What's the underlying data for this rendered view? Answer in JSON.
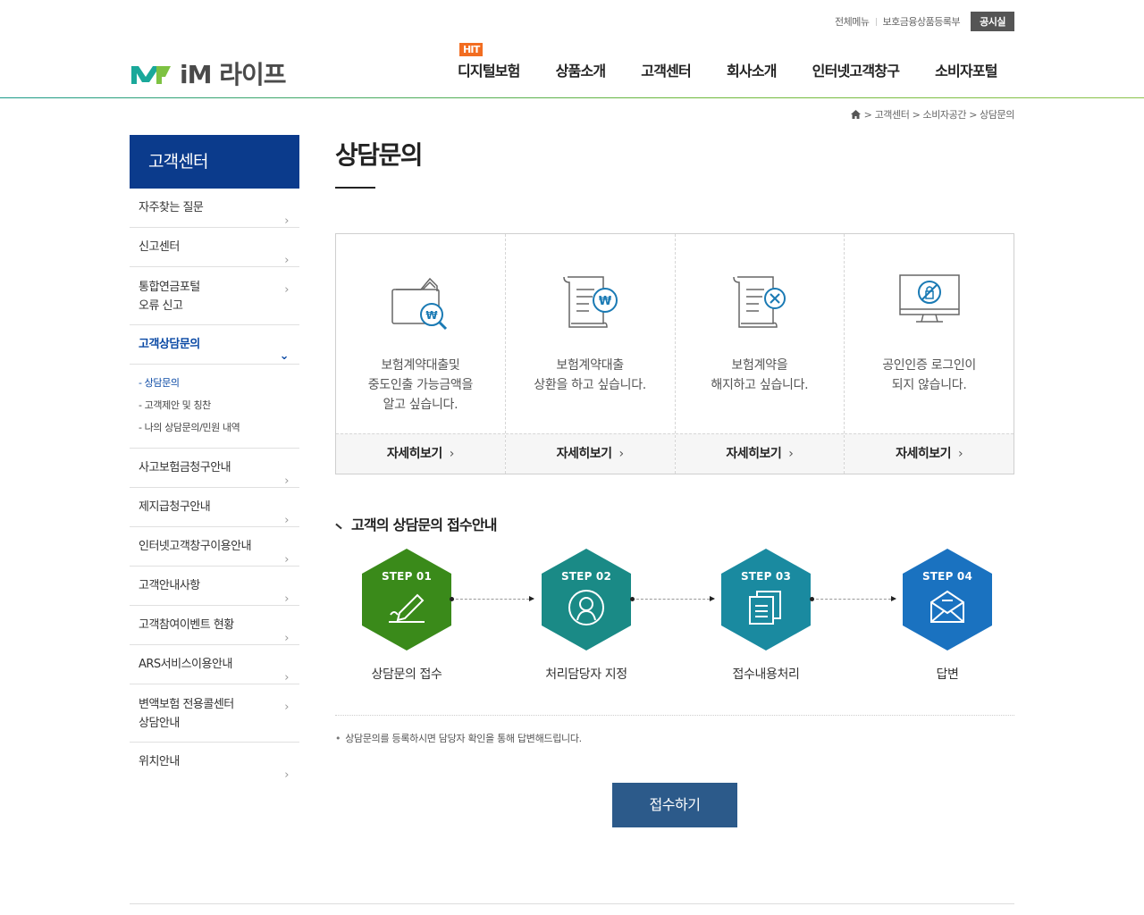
{
  "util": {
    "items": [
      "전체메뉴",
      "보호금융상품등록부"
    ],
    "notice": "공시실"
  },
  "logo": {
    "text": "iM 라이프"
  },
  "gnb": {
    "badge": "HIT",
    "items": [
      "디지털보험",
      "상품소개",
      "고객센터",
      "회사소개",
      "인터넷고객창구",
      "소비자포털"
    ]
  },
  "breadcrumb": [
    "고객센터",
    "소비자공간",
    "상담문의"
  ],
  "lnb": {
    "title": "고객센터",
    "items": [
      {
        "label": "자주찾는 질문"
      },
      {
        "label": "신고센터"
      },
      {
        "label": "통합연금포털\n오류 신고"
      },
      {
        "label": "고객상담문의"
      },
      {
        "label": "사고보험금청구안내"
      },
      {
        "label": "제지급청구안내"
      },
      {
        "label": "인터넷고객창구이용안내"
      },
      {
        "label": "고객안내사항"
      },
      {
        "label": "고객참여이벤트 현황"
      },
      {
        "label": "ARS서비스이용안내"
      },
      {
        "label": "변액보험 전용콜센터\n상담안내"
      },
      {
        "label": "위치안내"
      }
    ],
    "sub": [
      "상담문의",
      "고객제안 및 칭찬",
      "나의 상담문의/민원 내역"
    ]
  },
  "page_title": "상담문의",
  "cards": [
    {
      "icon": "wallet-search-icon",
      "desc": [
        "보험계약대출및",
        "중도인출 가능금액을",
        "알고 싶습니다."
      ],
      "more": "자세히보기"
    },
    {
      "icon": "scroll-won-icon",
      "desc": [
        "보험계약대출",
        "상환을 하고 싶습니다."
      ],
      "more": "자세히보기"
    },
    {
      "icon": "scroll-cancel-icon",
      "desc": [
        "보험계약을",
        "해지하고 싶습니다."
      ],
      "more": "자세히보기"
    },
    {
      "icon": "monitor-cert-icon",
      "desc": [
        "공인인증 로그인이",
        "되지 않습니다."
      ],
      "more": "자세히보기"
    }
  ],
  "section_title": "고객의 상담문의 접수안내",
  "steps": [
    {
      "label": "STEP 01",
      "name": "상담문의 접수",
      "color": "#3a8a1a",
      "icon": "pen-icon"
    },
    {
      "label": "STEP 02",
      "name": "처리담당자 지정",
      "color": "#1a8a86",
      "icon": "person-icon"
    },
    {
      "label": "STEP 03",
      "name": "접수내용처리",
      "color": "#1a8aa0",
      "icon": "documents-icon"
    },
    {
      "label": "STEP 04",
      "name": "답변",
      "color": "#1a72c0",
      "icon": "mail-icon"
    }
  ],
  "note": "상담문의를 등록하시면 담당자 확인을 통해 답변해드립니다.",
  "submit": "접수하기"
}
